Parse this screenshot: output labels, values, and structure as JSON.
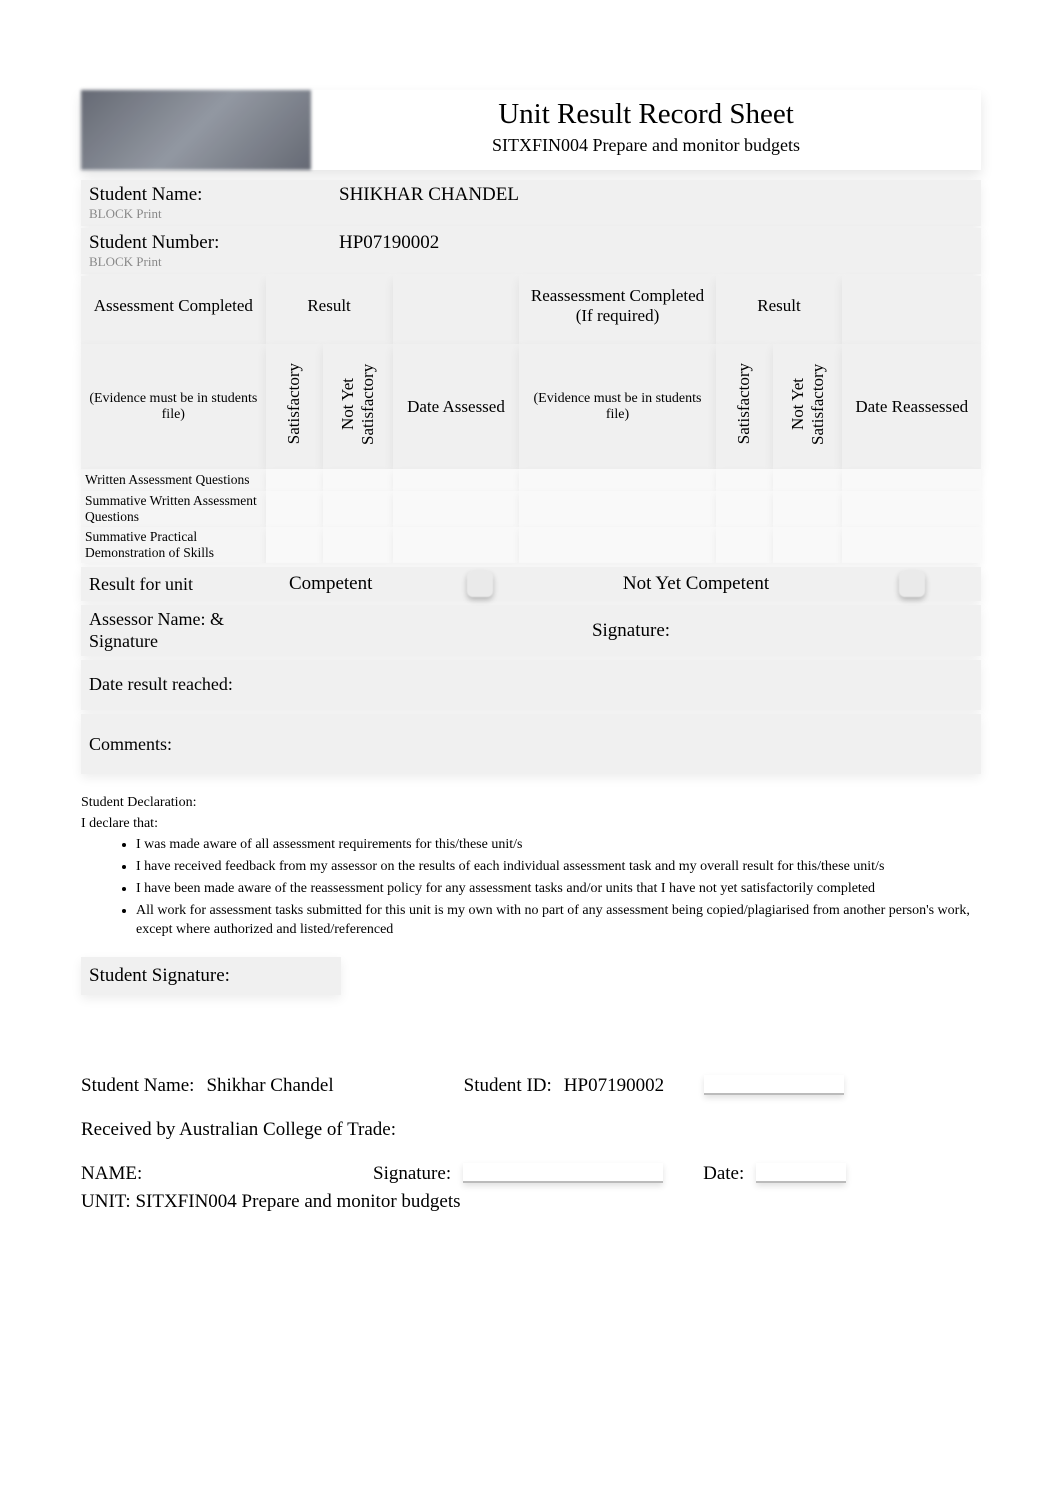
{
  "header": {
    "title": "Unit Result Record Sheet",
    "subtitle": "SITXFIN004 Prepare and monitor budgets"
  },
  "student": {
    "name_label": "Student Name:",
    "block_print": "BLOCK Print",
    "name_value": "SHIKHAR CHANDEL",
    "number_label": "Student Number:",
    "number_value": "HP07190002"
  },
  "table": {
    "h_assessment_completed": "Assessment Completed",
    "h_result": "Result",
    "h_reassessment": "Reassessment Completed (If required)",
    "evidence_note": "(Evidence must be in students file)",
    "col_sat": "Satisfactory",
    "col_nys": "Not Yet Satisfactory",
    "col_date_assessed": "Date Assessed",
    "evidence_note2": "(Evidence must be in students file)",
    "col_date_reassessed": "Date Reassessed",
    "rows": [
      "Written Assessment Questions",
      "Summative Written Assessment Questions",
      "Summative Practical Demonstration of Skills"
    ]
  },
  "result_unit": {
    "label": "Result for unit",
    "competent": "Competent",
    "not_yet": "Not Yet Competent"
  },
  "assessor": {
    "label": "Assessor Name: & Signature",
    "signature_label": "Signature:"
  },
  "date_result": {
    "label": "Date result reached:"
  },
  "comments": {
    "label": "Comments:"
  },
  "declaration": {
    "heading": "Student Declaration:",
    "intro": "I declare that:",
    "items": [
      "I was made aware of all assessment requirements for this/these unit/s",
      "I have received feedback from my assessor on the results of each individual assessment task and my overall result for this/these unit/s",
      "I have been made aware of the reassessment policy for any assessment tasks and/or units that I have not yet satisfactorily completed",
      "All work for assessment tasks submitted for this unit is my own with no part of any assessment being copied/plagiarised from another person's work, except where authorized and         listed/referenced"
    ]
  },
  "student_signature_label": "Student Signature:",
  "footer": {
    "name_label": "Student Name:",
    "name_value": "Shikhar Chandel",
    "id_label": "Student ID:",
    "id_value": "HP07190002",
    "received_by": "Received by Australian College of Trade:",
    "name2_label": "NAME:",
    "sig_label": "Signature:",
    "date_label": "Date:",
    "unit_label": "UNIT: SITXFIN004 Prepare and monitor budgets"
  }
}
